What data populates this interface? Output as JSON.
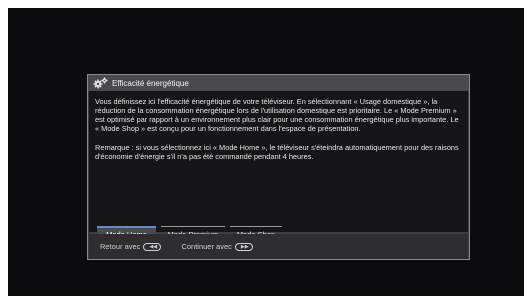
{
  "dialog": {
    "title": "Efficacité énergétique",
    "title_icon": "gears-icon",
    "paragraph1": "Vous définissez ici l'efficacité énergétique de votre téléviseur. En sélectionnant « Usage domestique », la réduction de la consommation énergétique lors de l'utilisation domestique est prioritaire. Le « Mode Premium » est optimisé par rapport à un environnement plus clair pour une consommation énergétique plus importante. Le « Mode Shop » est conçu pour un fonctionnement dans l'espace de présentation.",
    "paragraph2": "Remarque : si vous sélectionnez ici « Mode Home », le téléviseur s'éteindra automatiquement pour des raisons d'économie d'énergie s'il n'a pas été commandé pendant 4 heures.",
    "tabs": [
      {
        "label": "Mode Home",
        "selected": true
      },
      {
        "label": "Mode Premium",
        "selected": false
      },
      {
        "label": "Mode Shop",
        "selected": false
      }
    ]
  },
  "footer": {
    "back_label": "Retour avec",
    "back_icon": "back-button-icon",
    "continue_label": "Continuer avec",
    "continue_icon": "forward-button-icon"
  },
  "colors": {
    "accent": "#5a8ed0",
    "dialog_bg": "#3e3e40",
    "screen_bg": "#0c0c0e"
  }
}
